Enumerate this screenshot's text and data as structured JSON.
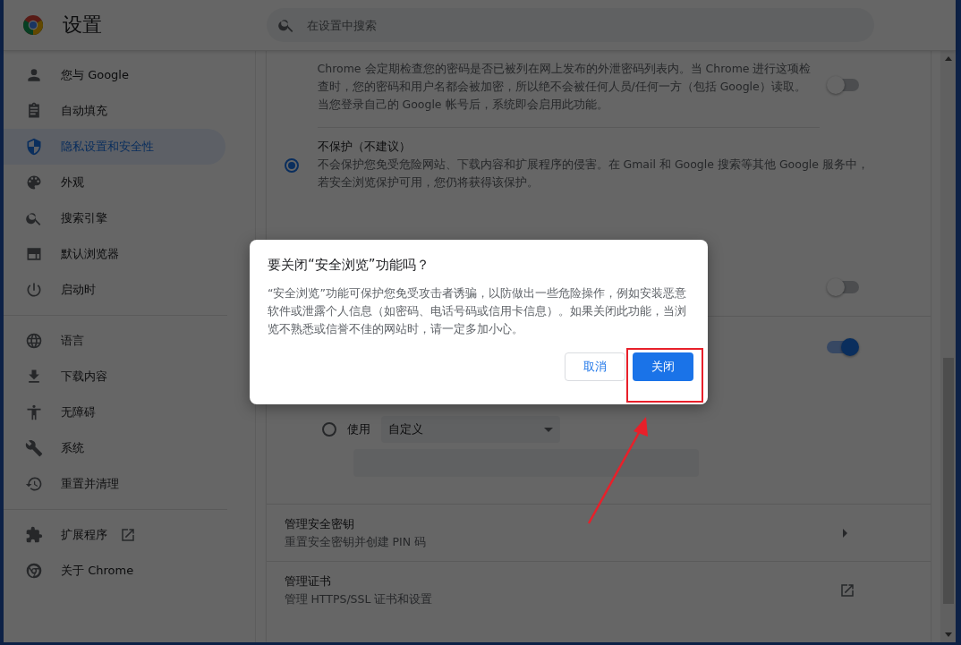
{
  "header": {
    "title": "设置",
    "search": {
      "placeholder": "在设置中搜索"
    }
  },
  "sidebar": {
    "groups": [
      {
        "items": [
          {
            "label": "您与 Google",
            "selected": false
          },
          {
            "label": "自动填充",
            "selected": false
          },
          {
            "label": "隐私设置和安全性",
            "selected": true
          },
          {
            "label": "外观",
            "selected": false
          },
          {
            "label": "搜索引擎",
            "selected": false
          },
          {
            "label": "默认浏览器",
            "selected": false
          },
          {
            "label": "启动时",
            "selected": false
          }
        ]
      },
      {
        "items": [
          {
            "label": "语言",
            "selected": false
          },
          {
            "label": "下载内容",
            "selected": false
          },
          {
            "label": "无障碍",
            "selected": false
          },
          {
            "label": "系统",
            "selected": false
          },
          {
            "label": "重置并清理",
            "selected": false
          }
        ]
      },
      {
        "items": [
          {
            "label": "扩展程序",
            "selected": false,
            "external": true
          },
          {
            "label": "关于 Chrome",
            "selected": false
          }
        ]
      }
    ]
  },
  "main": {
    "sections": [
      {
        "kind": "toggle_setting",
        "description": [
          "Chrome 会定期检查您的密码是否已被列在网上发布的外泄密码列表内。当 Chrome 进行这项检",
          "查时，您的密码和用户名都会被加密，所以绝不会被任何人员/任何一方（包括 Google）读取。",
          "当您登录自己的 Google 帐号后，系统即会启用此功能。"
        ],
        "on": false
      },
      {
        "kind": "radio_option",
        "title": "不保护（不建议）",
        "description": [
          "不会保护您免受危险网站、下载内容和扩展程序的侵害。在 Gmail 和 Google 搜索等其他 Google 服务中，",
          "若安全浏览保护可用，您仍将获得该保护。"
        ],
        "selected": true
      },
      {
        "kind": "toggle_row",
        "on": false
      },
      {
        "kind": "toggle_row",
        "on": true
      },
      {
        "kind": "dns",
        "option": {
          "label": "使用",
          "selected": false,
          "value": "自定义"
        }
      },
      {
        "kind": "submenu_row",
        "title": "管理安全密钥",
        "subtitle": "重置安全密钥并创建 PIN 码"
      },
      {
        "kind": "external_row",
        "title": "管理证书",
        "subtitle": "管理 HTTPS/SSL 证书和设置"
      }
    ]
  },
  "dialog": {
    "title": "要关闭“安全浏览”功能吗？",
    "body": "“安全浏览”功能可保护您免受攻击者诱骗，以防做出一些危险操作，例如安装恶意软件或泄露个人信息（如密码、电话号码或信用卡信息）。如果关闭此功能，当浏览不熟悉或信誉不佳的网站时，请一定多加小心。",
    "buttons": [
      {
        "label": "取消",
        "kind": "secondary"
      },
      {
        "label": "关闭",
        "kind": "primary"
      }
    ]
  }
}
